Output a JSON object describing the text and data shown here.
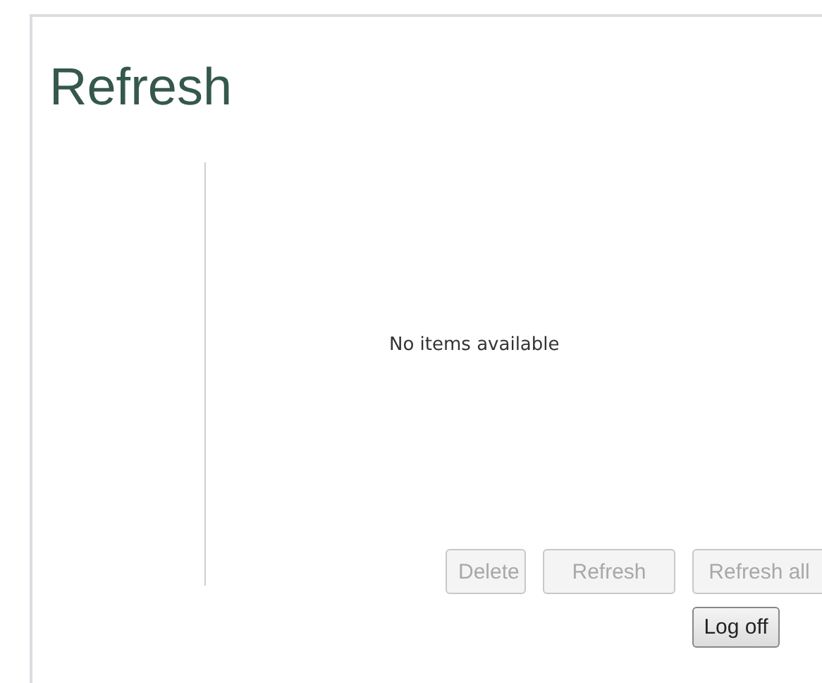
{
  "title": "Refresh",
  "list": {
    "empty_text": "No items available"
  },
  "buttons": [
    {
      "label": "Delete",
      "disabled": true
    },
    {
      "label": "Refresh",
      "disabled": true
    },
    {
      "label": "Refresh all",
      "disabled": true
    }
  ],
  "logoff": {
    "label": "Log off",
    "disabled": false
  }
}
